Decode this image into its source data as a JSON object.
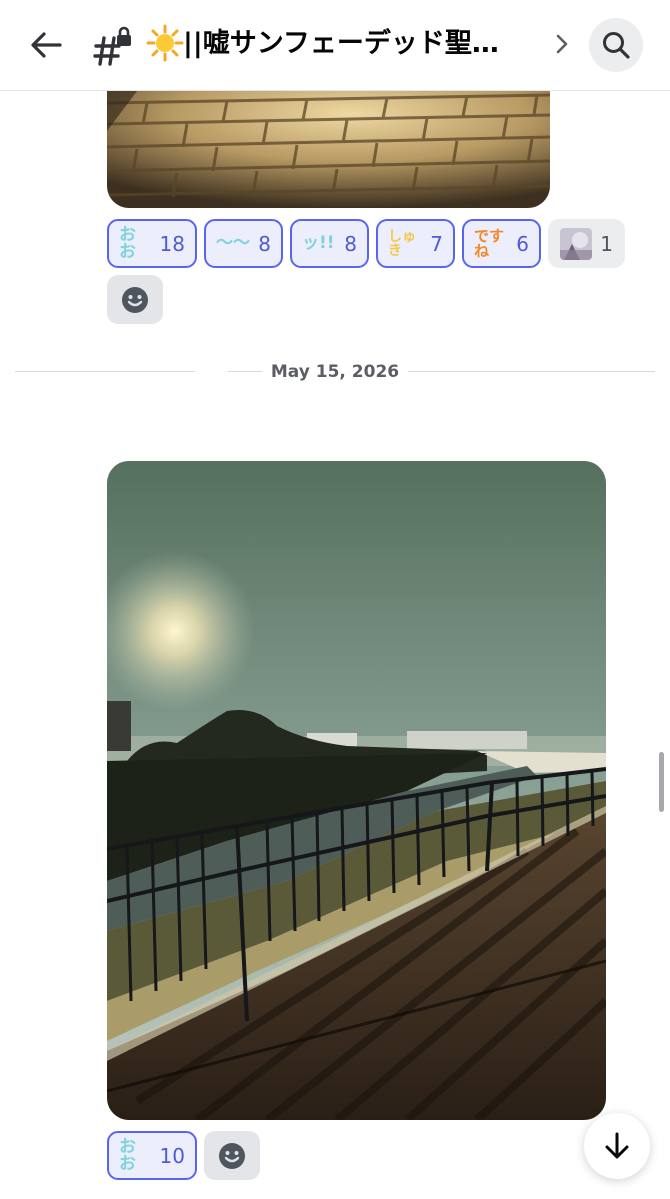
{
  "header": {
    "title": "||嘘サンフェーデッド聖…",
    "back_icon": "arrow-left-icon",
    "channel_icon": "locked-hash-icon",
    "channel_emoji": "sun-emoji",
    "chevron_icon": "chevron-right-icon",
    "search_icon": "search-icon"
  },
  "message1": {
    "reactions": [
      {
        "emoji_text": "おお",
        "emoji_color": "#7fd3e0",
        "count": "18"
      },
      {
        "emoji_text": "〜〜",
        "emoji_color": "#7fd3e0",
        "count": "8"
      },
      {
        "emoji_text": "ッ!!",
        "emoji_color": "#7fd3e0",
        "count": "8"
      },
      {
        "emoji_text": "しゅき",
        "emoji_color": "#f2c94c",
        "count": "7"
      },
      {
        "emoji_text": "ですね",
        "emoji_color": "#f2872c",
        "count": "6"
      },
      {
        "emoji_text": "",
        "emoji_color": "#b9b3c4",
        "count": "1"
      }
    ],
    "add_reaction_icon": "smiley-icon"
  },
  "date_divider": "May 15, 2026",
  "message2": {
    "reactions": [
      {
        "emoji_text": "おお",
        "emoji_color": "#7fd3e0",
        "count": "10"
      }
    ],
    "add_reaction_icon": "smiley-icon"
  },
  "jump_icon": "arrow-down-icon",
  "colors": {
    "accent": "#5865f2",
    "reaction_bg": "#eceefb"
  }
}
